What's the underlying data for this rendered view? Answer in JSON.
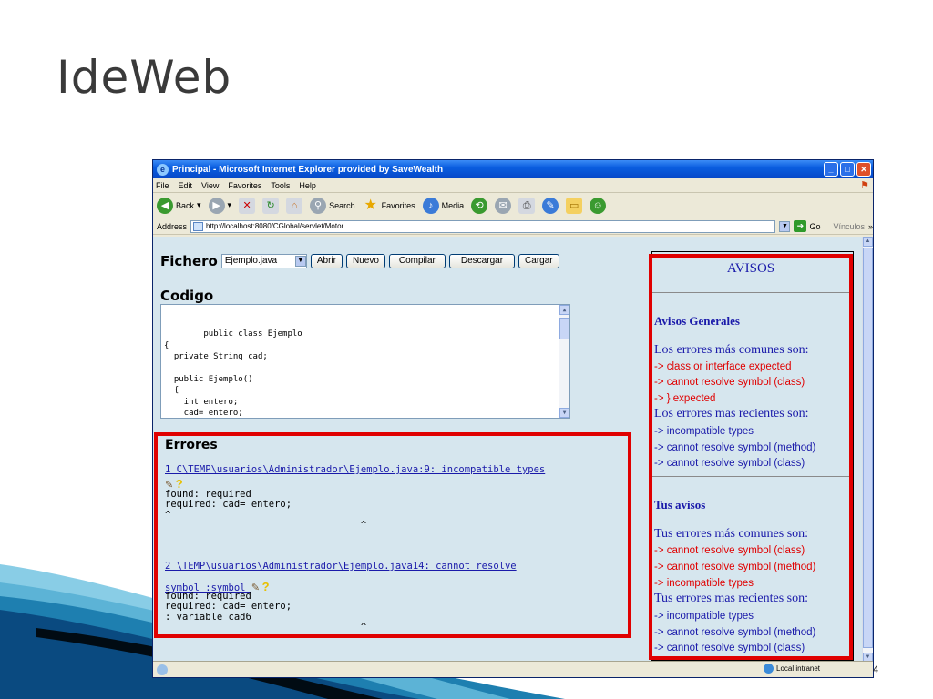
{
  "slide": {
    "title": "IdeWeb",
    "number": "4"
  },
  "window": {
    "title": "Principal - Microsoft Internet Explorer provided by SaveWealth",
    "menu": [
      "File",
      "Edit",
      "View",
      "Favorites",
      "Tools",
      "Help"
    ],
    "toolbar": {
      "back": "Back",
      "search": "Search",
      "favorites": "Favorites",
      "media": "Media"
    },
    "address": {
      "label": "Address",
      "url": "http://localhost:8080/CGlobal/servlet/Motor",
      "go": "Go",
      "links": "Vínculos"
    },
    "status": {
      "zone": "Local intranet"
    }
  },
  "left": {
    "fichero_label": "Fichero",
    "file_select": "Ejemplo.java",
    "buttons": [
      "Abrir",
      "Nuevo",
      "Compilar",
      "Descargar",
      "Cargar"
    ],
    "codigo_label": "Codigo",
    "code": "public class Ejemplo\n{\n  private String cad;\n\n  public Ejemplo()\n  {\n    int entero;\n    cad= entero;\n  }",
    "errores_label": "Errores",
    "errors": [
      {
        "link": "1 C\\TEMP\\usuarios\\Administrador\\Ejemplo.java:9: incompatible types",
        "detail": "found: required\nrequired: cad= entero;\n^\n                                  ^"
      },
      {
        "link_line1": "2 \\TEMP\\usuarios\\Administrador\\Ejemplo.java14: cannot resolve",
        "link_line2": "symbol :symbol ",
        "detail": "found: required\nrequired: cad= entero;\n: variable cad6\n                                  ^"
      }
    ]
  },
  "avisos": {
    "title": "AVISOS",
    "generales_heading": "Avisos Generales",
    "generales_comunes": "Los errores más comunes son:",
    "generales_comunes_items": [
      "-> class or interface expected",
      "-> cannot resolve symbol (class)",
      "-> } expected"
    ],
    "generales_recientes": "Los errores mas recientes son:",
    "generales_recientes_items": [
      "-> incompatible types",
      "-> cannot resolve symbol (method)",
      "-> cannot resolve symbol (class)"
    ],
    "tus_heading": "Tus avisos",
    "tus_comunes": "Tus errores más comunes son:",
    "tus_comunes_items": [
      "-> cannot resolve symbol (class)",
      "-> cannot resolve symbol (method)",
      "-> incompatible types"
    ],
    "tus_recientes": "Tus errores mas recientes son:",
    "tus_recientes_items": [
      "-> incompatible types",
      "-> cannot resolve symbol (method)",
      "-> cannot resolve symbol (class)"
    ]
  }
}
